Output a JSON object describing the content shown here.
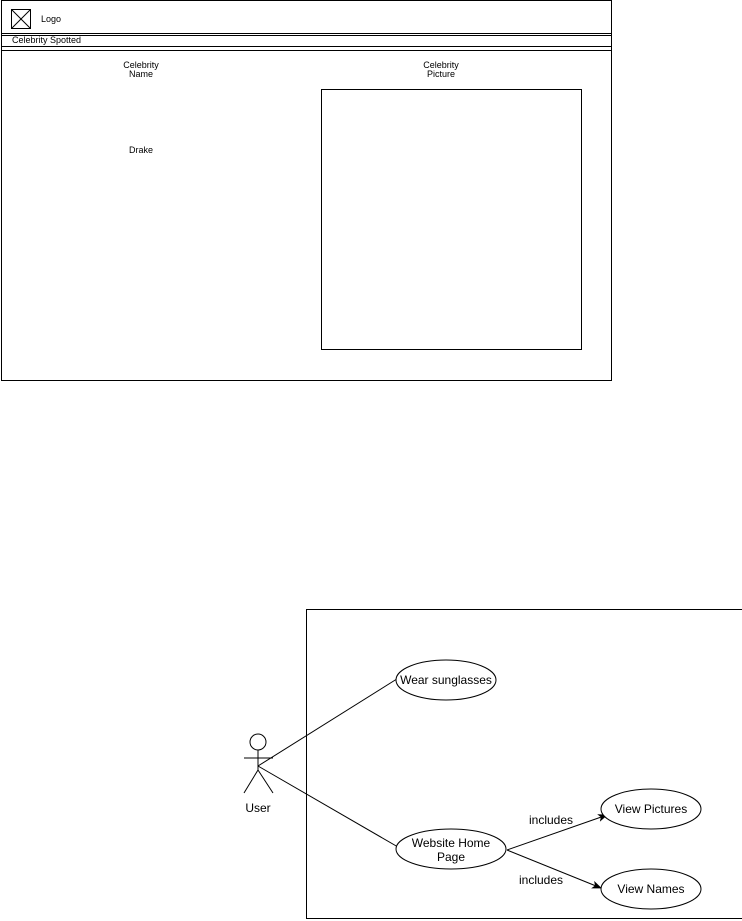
{
  "wireframe": {
    "logo_label": "Logo",
    "banner_title": "Celebrity Spotted",
    "columns": {
      "name_header_line1": "Celebrity",
      "name_header_line2": "Name",
      "picture_header_line1": "Celebrity",
      "picture_header_line2": "Picture"
    },
    "celebrity_name": "Drake"
  },
  "use_case_diagram": {
    "actor": {
      "name": "User"
    },
    "use_cases": {
      "wear_sunglasses": "Wear sunglasses",
      "website_home_line1": "Website Home",
      "website_home_line2": "Page",
      "view_pictures": "View Pictures",
      "view_names": "View Names"
    },
    "relations": {
      "includes_pictures": "includes",
      "includes_names": "includes"
    }
  }
}
